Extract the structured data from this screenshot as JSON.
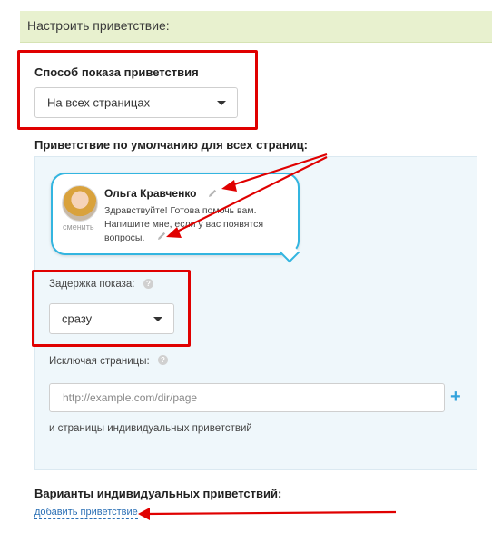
{
  "header": {
    "title": "Настроить приветствие:"
  },
  "display_mode": {
    "label": "Способ показа приветствия",
    "selected": "На всех страницах"
  },
  "default_greeting": {
    "label": "Приветствие по умолчанию для всех страниц:",
    "agent_name": "Ольга Кравченко",
    "change_label": "сменить",
    "message": "Здравствуйте! Готова помочь вам. Напишите мне, если у вас появятся вопросы."
  },
  "delay": {
    "label": "Задержка показа:",
    "selected": "сразу"
  },
  "exclude": {
    "label": "Исключая страницы:",
    "placeholder": "http://example.com/dir/page",
    "note": "и страницы индивидуальных приветствий"
  },
  "individual": {
    "label": "Варианты индивидуальных приветствий:",
    "add_link": "добавить приветствие"
  },
  "icons": {
    "dropdown": "chevron-down-icon",
    "edit": "pencil-icon",
    "help": "question-icon",
    "add": "plus-icon"
  },
  "colors": {
    "header_bg": "#e8f1cf",
    "accent": "#33b5e0",
    "annotation": "#e00000",
    "link": "#2a6fb5"
  }
}
